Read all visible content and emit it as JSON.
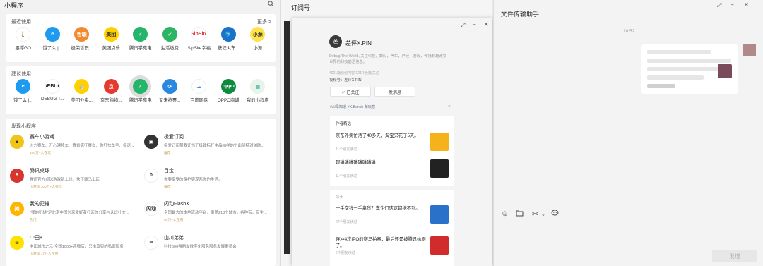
{
  "miniprograms": {
    "title": "小程序",
    "search_icon": "search-icon",
    "recent": {
      "title": "最近使用",
      "more": "更多 >",
      "apps": [
        {
          "label": "墨浮GO",
          "color": "#ffffff",
          "text": "🚶",
          "fg": "#333"
        },
        {
          "label": "饿了么 |...",
          "color": "#1e9bf0",
          "text": "e",
          "fg": "#fff"
        },
        {
          "label": "极荣哲职...",
          "color": "#f08a2c",
          "text": "哲职",
          "fg": "#fff"
        },
        {
          "label": "美团点餐",
          "color": "#ffd100",
          "text": "美团",
          "fg": "#333"
        },
        {
          "label": "腾讯学充电",
          "color": "#24b56b",
          "text": "⚡",
          "fg": "#fff"
        },
        {
          "label": "生活缴费",
          "color": "#2bb463",
          "text": "✔",
          "fg": "#fff"
        },
        {
          "label": "SipSite幸福",
          "color": "#ffffff",
          "text": "SipSite",
          "fg": "#d33"
        },
        {
          "label": "携程火车...",
          "color": "#1a73c8",
          "text": "🐬",
          "fg": "#fff"
        },
        {
          "label": "小源",
          "color": "#ffe24c",
          "text": "小源",
          "fg": "#333"
        }
      ]
    },
    "suggest": {
      "title": "建议使用",
      "apps": [
        {
          "label": "饿了么 |...",
          "color": "#1e9bf0",
          "text": "e",
          "fg": "#fff"
        },
        {
          "label": "DEBUG T...",
          "color": "#ffffff",
          "text": "DEBUG",
          "fg": "#222"
        },
        {
          "label": "美团外卖...",
          "color": "#ffd100",
          "text": "🐰",
          "fg": "#333"
        },
        {
          "label": "京东购物...",
          "color": "#e63a2e",
          "text": "京",
          "fg": "#fff"
        },
        {
          "label": "腾讯学充电",
          "color": "#24b56b",
          "text": "⚡",
          "fg": "#fff",
          "selected": true
        },
        {
          "label": "又来抢票...",
          "color": "#2b88e0",
          "text": "⟳",
          "fg": "#fff"
        },
        {
          "label": "百度网盘",
          "color": "#ffffff",
          "text": "☁",
          "fg": "#3a8ef0"
        },
        {
          "label": "OPPO商城",
          "color": "#0e8a3c",
          "text": "oppo",
          "fg": "#fff"
        },
        {
          "label": "我的小程序",
          "color": "#e8f3ea",
          "text": "▦",
          "fg": "#2a9"
        }
      ]
    },
    "discover": {
      "title": "发现小程序",
      "items": [
        {
          "name": "赛车小游戏",
          "desc": "火力赛车、开心漂移车、赛肯疯狂赛车、狗狂快车手、极速...",
          "tag": "100万+人在玩",
          "color": "#f0c419",
          "text": "●"
        },
        {
          "name": "极爱订阅",
          "desc": "极爱订阅帮我证书于极致标杆电品抽样的宁出随特对辅助...",
          "tag": "推荐",
          "color": "#333333",
          "text": "▣"
        },
        {
          "name": "腾讯桌球",
          "desc": "腾讯官方桌球游戏新上线，快下载马上玩!",
          "tag": "小游戏  300万+人在玩",
          "color": "#d8352f",
          "text": "8"
        },
        {
          "name": "目宝",
          "desc": "你要享受的保护实现系你的生活。",
          "tag": "推荐",
          "color": "#ffffff",
          "text": "0"
        },
        {
          "name": "我的犯摊",
          "desc": "\"我的犯摊\"是北京中国为享爱好者打造的分享与认识社交...",
          "tag": "热门",
          "color": "#ffb400",
          "text": "摊"
        },
        {
          "name": "闪动FlashX",
          "desc": "全国最大的本地流动平台，覆盖218个城市，各种有，有生...",
          "tag": "90万+人在用",
          "color": "#ffffff",
          "text": "闪动"
        },
        {
          "name": "中田+",
          "desc": "中田城市之元·全国1000+连锁店，只推真实的私家服务",
          "tag": "小游戏  1万+人在用",
          "color": "#ffe300",
          "text": "⊙"
        },
        {
          "name": "山川弟弟",
          "desc": "科技500强朋友数字化服务服务发展委员会",
          "tag": "",
          "color": "#ffffff",
          "text": "∞"
        }
      ]
    }
  },
  "subscriptions": {
    "title": "订阅号",
    "popup": {
      "account_name": "差评X.PIN",
      "avatar_text": "差",
      "description": "Debug The World, 关注科技，数码，汽车，产经，游戏，传播有趣改变世界的科技前沿信息。",
      "meta": "4021篇原创内容  121个朋友关注",
      "video": "视频号：差评X.PIN",
      "followed_label": "✓ 已关注",
      "message_label": "发消息",
      "tags": "#AI早知道        #X.Bench 新玩意",
      "author_pick_title": "作者精选",
      "picks": [
        {
          "title": "京东外卖忙活了40多天，淘宝只花了5天。",
          "meta": "11个朋友读过",
          "thumb": "#f6b21a"
        },
        {
          "title": "现磷磷磷磷磷磷磷磷",
          "meta": "11个朋友读过",
          "thumb": "#222222"
        }
      ],
      "today_title": "今天",
      "today": [
        {
          "title": "一手交钱一手拿货？车企们这这都拆不到。",
          "meta": "27个朋友读过",
          "thumb": "#2a72c9"
        },
        {
          "title": "连冲4次IPO的赛马拍赛，最后还是被腾讯给刷了。",
          "meta": "6个朋友读过",
          "thumb": "#d22b2b"
        }
      ]
    }
  },
  "file_transfer": {
    "title": "文件传输助手",
    "time": "10:52",
    "send_label": "发送",
    "tools": [
      "emoji-icon",
      "folder-icon",
      "scissors-icon",
      "chat-icon"
    ]
  }
}
